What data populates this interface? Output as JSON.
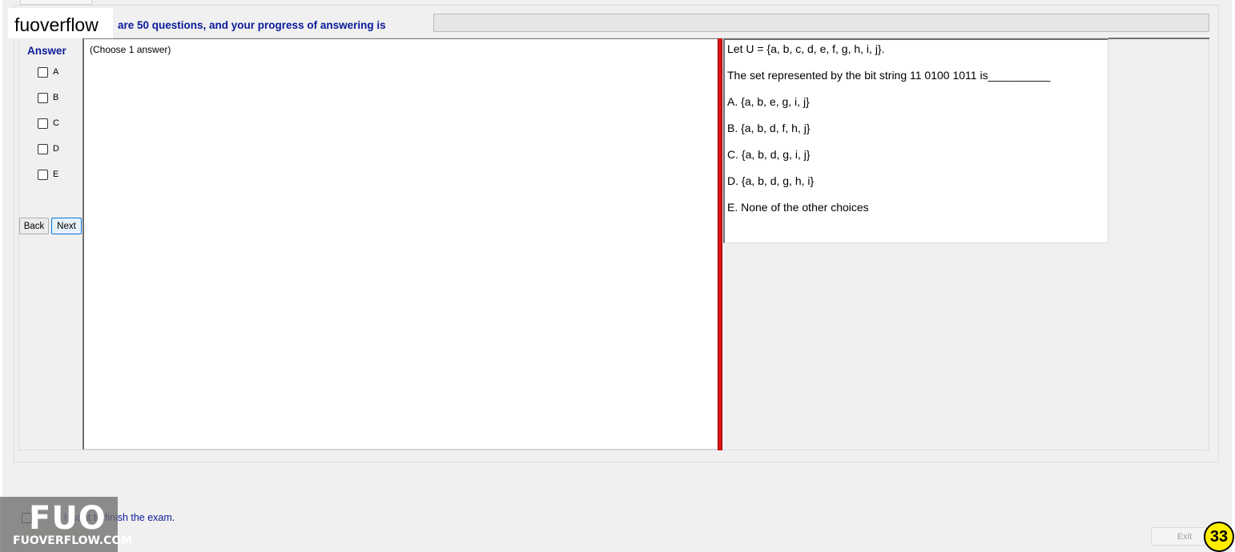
{
  "header": {
    "watermark_text": "fuoverflow",
    "progress_text": "are 50 questions, and your progress of answering is",
    "progress_fraction": 0
  },
  "answer_panel": {
    "label": "Answer",
    "options": [
      "A",
      "B",
      "C",
      "D",
      "E"
    ],
    "back_label": "Back",
    "next_label": "Next",
    "choose_hint": "(Choose 1 answer)"
  },
  "question": {
    "lines": [
      "Let U = {a, b, c, d, e, f, g, h, i, j}.",
      "The set represented by the bit string 11 0100 1011 is__________",
      "A.  {a, b, e, g, i, j}",
      "B.  {a, b, d, f, h, j}",
      "C.  {a, b, d, g, i, j}",
      "D.  {a, b, d, g, h, i}",
      "E.  None of the other choices"
    ]
  },
  "footer": {
    "finish_text": "I want to finish the exam.",
    "exit_label": "Exit",
    "page_number": "33",
    "watermark_logo": "FUO",
    "watermark_site": "FUOVERFLOW.COM"
  },
  "colors": {
    "label_blue": "#0a1a9a",
    "splitter_red": "#e01010",
    "badge_yellow": "#ffee00"
  }
}
